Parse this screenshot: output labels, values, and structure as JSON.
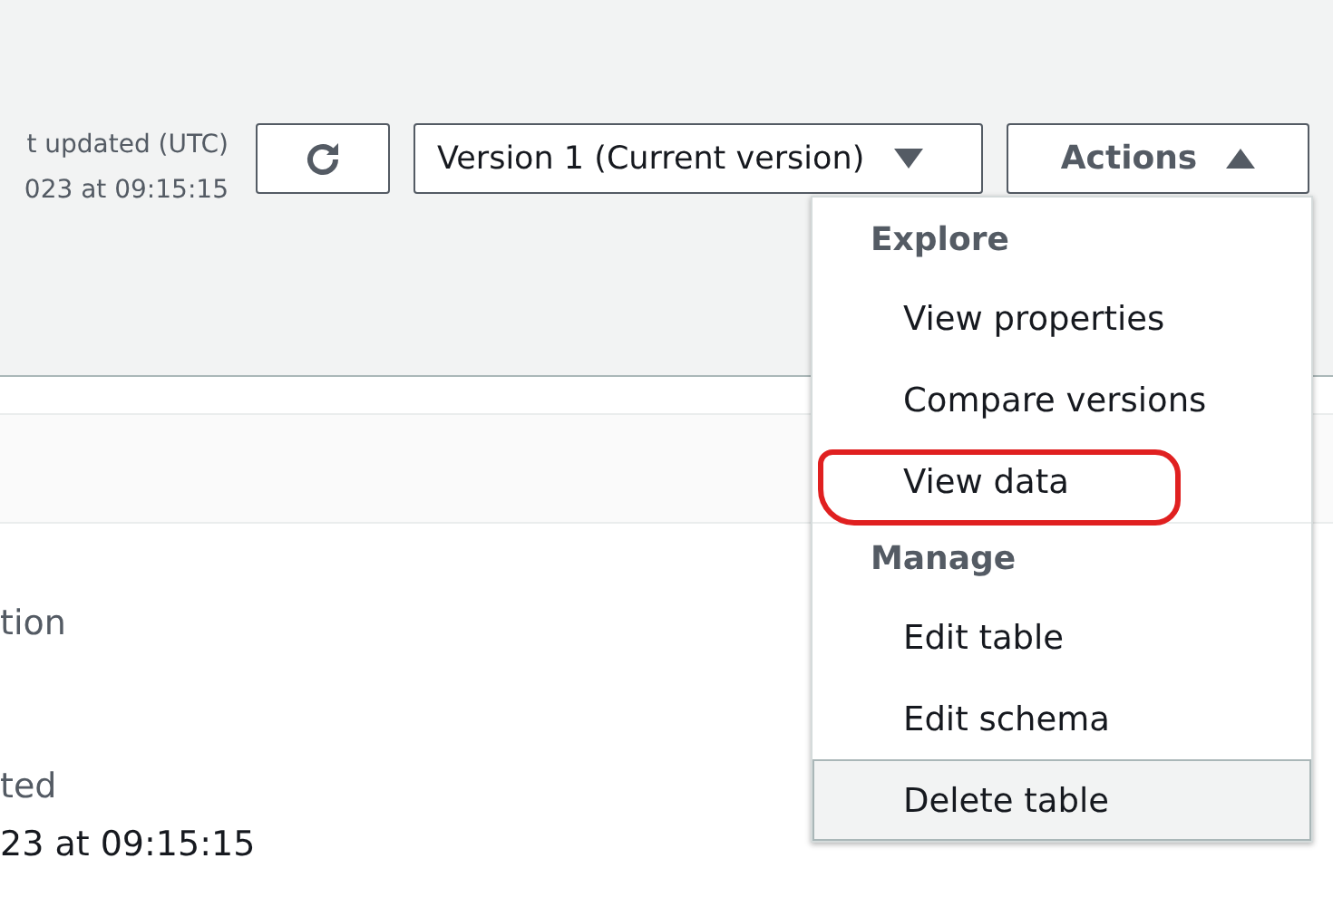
{
  "header": {
    "meta_label": "t updated (UTC)",
    "meta_value": "023 at 09:15:15",
    "version_select": "Version 1 (Current version)",
    "actions_button": {
      "label": "Actions",
      "expanded": true
    }
  },
  "details": [
    {
      "label": "tion"
    },
    {
      "label": "ted",
      "value": "23 at 09:15:15"
    }
  ],
  "actions_menu": [
    {
      "heading": "Explore",
      "items": [
        {
          "label": "View properties",
          "hovered": false,
          "annotated": false
        },
        {
          "label": "Compare versions",
          "hovered": false,
          "annotated": false
        },
        {
          "label": "View data",
          "hovered": false,
          "annotated": true
        }
      ]
    },
    {
      "heading": "Manage",
      "items": [
        {
          "label": "Edit table",
          "hovered": false,
          "annotated": false
        },
        {
          "label": "Edit schema",
          "hovered": false,
          "annotated": false
        },
        {
          "label": "Delete table",
          "hovered": true,
          "annotated": false
        }
      ]
    }
  ]
}
